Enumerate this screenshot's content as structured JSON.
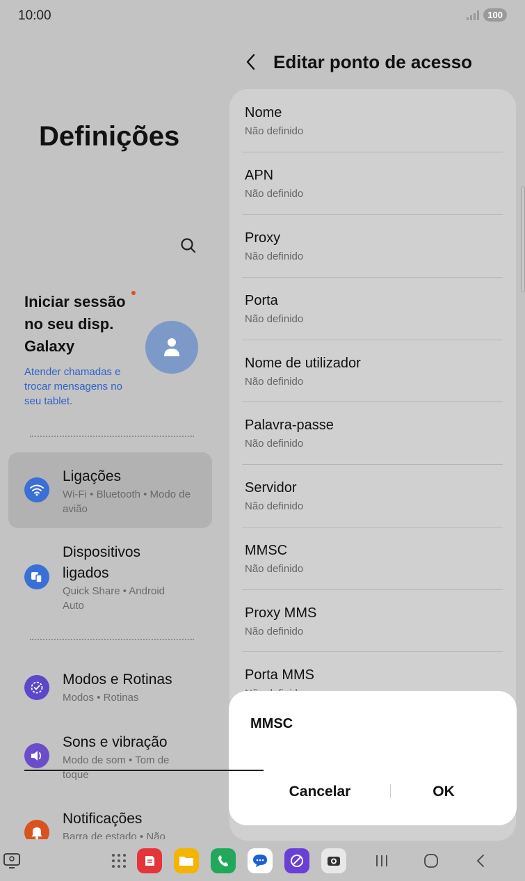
{
  "status_bar": {
    "time": "10:00",
    "battery": "100"
  },
  "left_pane": {
    "title": "Definições",
    "account": {
      "title": "Iniciar sessão no seu disp. Galaxy",
      "subtitle": "Atender chamadas e trocar mensagens no seu tablet."
    },
    "menu": [
      {
        "title": "Ligações",
        "subtitle": "Wi-Fi • Bluetooth • Modo de avião",
        "icon": "wifi-icon",
        "color": "#3a6fd6"
      },
      {
        "title": "Dispositivos ligados",
        "subtitle": "Quick Share • Android Auto",
        "icon": "connected-devices-icon",
        "color": "#3a6fd6"
      },
      {
        "title": "Modos e Rotinas",
        "subtitle": "Modos • Rotinas",
        "icon": "modes-icon",
        "color": "#5b47c7"
      },
      {
        "title": "Sons e vibração",
        "subtitle": "Modo de som • Tom de toque",
        "icon": "sound-icon",
        "color": "#6b4cc9"
      },
      {
        "title": "Notificações",
        "subtitle": "Barra de estado • Não",
        "icon": "bell-icon",
        "color": "#d9531e"
      }
    ]
  },
  "right_pane": {
    "title": "Editar ponto de acesso",
    "fields": [
      {
        "label": "Nome",
        "value": "Não definido"
      },
      {
        "label": "APN",
        "value": "Não definido"
      },
      {
        "label": "Proxy",
        "value": "Não definido"
      },
      {
        "label": "Porta",
        "value": "Não definido"
      },
      {
        "label": "Nome de utilizador",
        "value": "Não definido"
      },
      {
        "label": "Palavra-passe",
        "value": "Não definido"
      },
      {
        "label": "Servidor",
        "value": "Não definido"
      },
      {
        "label": "MMSC",
        "value": "Não definido"
      },
      {
        "label": "Proxy MMS",
        "value": "Não definido"
      },
      {
        "label": "Porta MMS",
        "value": "Não definido"
      }
    ]
  },
  "dialog": {
    "title": "MMSC",
    "input_value": "",
    "cancel_label": "Cancelar",
    "ok_label": "OK"
  },
  "navbar": {
    "apps": [
      "apps-grid-icon",
      "notes-app-icon",
      "files-app-icon",
      "phone-app-icon",
      "messages-app-icon",
      "browser-app-icon",
      "camera-app-icon"
    ]
  }
}
